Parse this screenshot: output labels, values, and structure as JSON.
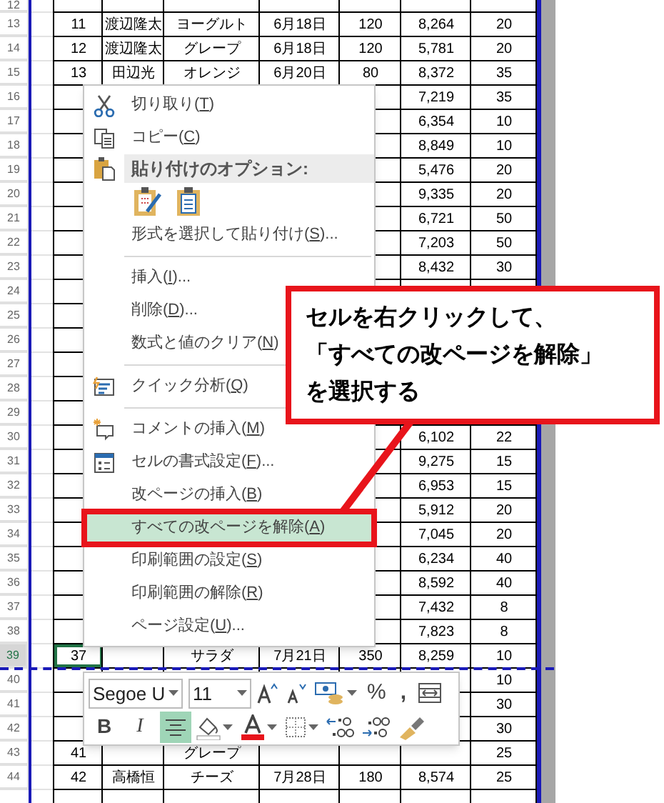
{
  "sheet": {
    "rows": [
      {
        "number": "12",
        "selected": false,
        "page_break_after": false,
        "cells": {}
      },
      {
        "number": "13",
        "selected": false,
        "page_break_after": false,
        "cells": {
          "column_1": "11",
          "column_2": "渡辺隆太",
          "column_3": "ヨーグルト",
          "column_4": "6月18日",
          "column_5": "120",
          "column_6": "8,264",
          "column_7": "20"
        }
      },
      {
        "number": "14",
        "selected": false,
        "page_break_after": false,
        "cells": {
          "column_1": "12",
          "column_2": "渡辺隆太",
          "column_3": "グレープ",
          "column_4": "6月18日",
          "column_5": "120",
          "column_6": "5,781",
          "column_7": "20"
        }
      },
      {
        "number": "15",
        "selected": false,
        "page_break_after": false,
        "cells": {
          "column_1": "13",
          "column_2": "田辺光",
          "column_3": "オレンジ",
          "column_4": "6月20日",
          "column_5": "80",
          "column_6": "8,372",
          "column_7": "35"
        }
      },
      {
        "number": "16",
        "selected": false,
        "page_break_after": false,
        "cells": {
          "column_6": "7,219",
          "column_7": "35"
        }
      },
      {
        "number": "17",
        "selected": false,
        "page_break_after": false,
        "cells": {
          "column_6": "6,354",
          "column_7": "10"
        }
      },
      {
        "number": "18",
        "selected": false,
        "page_break_after": false,
        "cells": {
          "column_6": "8,849",
          "column_7": "10"
        }
      },
      {
        "number": "19",
        "selected": false,
        "page_break_after": false,
        "cells": {
          "column_6": "5,476",
          "column_7": "20"
        }
      },
      {
        "number": "20",
        "selected": false,
        "page_break_after": false,
        "cells": {
          "column_6": "9,335",
          "column_7": "20"
        }
      },
      {
        "number": "21",
        "selected": false,
        "page_break_after": false,
        "cells": {
          "column_6": "6,721",
          "column_7": "50"
        }
      },
      {
        "number": "22",
        "selected": false,
        "page_break_after": false,
        "cells": {
          "column_6": "7,203",
          "column_7": "50"
        }
      },
      {
        "number": "23",
        "selected": false,
        "page_break_after": false,
        "cells": {
          "column_6": "8,432",
          "column_7": "30"
        }
      },
      {
        "number": "24",
        "selected": false,
        "page_break_after": false,
        "cells": {}
      },
      {
        "number": "25",
        "selected": false,
        "page_break_after": false,
        "cells": {}
      },
      {
        "number": "26",
        "selected": false,
        "page_break_after": false,
        "cells": {}
      },
      {
        "number": "27",
        "selected": false,
        "page_break_after": false,
        "cells": {}
      },
      {
        "number": "28",
        "selected": false,
        "page_break_after": false,
        "cells": {}
      },
      {
        "number": "29",
        "selected": false,
        "page_break_after": false,
        "cells": {}
      },
      {
        "number": "30",
        "selected": false,
        "page_break_after": false,
        "cells": {
          "column_6": "6,102",
          "column_7": "22"
        }
      },
      {
        "number": "31",
        "selected": false,
        "page_break_after": false,
        "cells": {
          "column_6": "9,275",
          "column_7": "15"
        }
      },
      {
        "number": "32",
        "selected": false,
        "page_break_after": false,
        "cells": {
          "column_6": "6,953",
          "column_7": "15"
        }
      },
      {
        "number": "33",
        "selected": false,
        "page_break_after": false,
        "cells": {
          "column_6": "5,912",
          "column_7": "20"
        }
      },
      {
        "number": "34",
        "selected": false,
        "page_break_after": false,
        "cells": {
          "column_6": "7,045",
          "column_7": "20"
        }
      },
      {
        "number": "35",
        "selected": false,
        "page_break_after": false,
        "cells": {
          "column_6": "6,234",
          "column_7": "40"
        }
      },
      {
        "number": "36",
        "selected": false,
        "page_break_after": false,
        "cells": {
          "column_6": "8,592",
          "column_7": "40"
        }
      },
      {
        "number": "37",
        "selected": false,
        "page_break_after": false,
        "cells": {
          "column_6": "7,432",
          "column_7": "8"
        }
      },
      {
        "number": "38",
        "selected": false,
        "page_break_after": false,
        "cells": {
          "column_6": "7,823",
          "column_7": "8"
        }
      },
      {
        "number": "39",
        "selected": true,
        "page_break_after": true,
        "cells": {
          "column_1": "37",
          "column_3": "サラダ",
          "column_4": "7月21日",
          "column_5": "350",
          "column_6": "8,259",
          "column_7": "10"
        }
      },
      {
        "number": "40",
        "selected": false,
        "page_break_after": false,
        "cells": {
          "column_7": "10"
        }
      },
      {
        "number": "41",
        "selected": false,
        "page_break_after": false,
        "cells": {
          "column_7": "30"
        }
      },
      {
        "number": "42",
        "selected": false,
        "page_break_after": false,
        "cells": {
          "column_7": "30"
        }
      },
      {
        "number": "43",
        "selected": false,
        "page_break_after": false,
        "cells": {
          "column_1": "41",
          "column_3": "グレープ",
          "column_7": "25"
        }
      },
      {
        "number": "44",
        "selected": false,
        "page_break_after": false,
        "cells": {
          "column_1": "42",
          "column_2": "高橋恒",
          "column_3": "チーズ",
          "column_4": "7月28日",
          "column_5": "180",
          "column_6": "8,574",
          "column_7": "25"
        }
      }
    ]
  },
  "context_menu": {
    "items": [
      {
        "kind": "item",
        "label": "切り取り(",
        "key": "T",
        "after": ")",
        "selected": false
      },
      {
        "kind": "item",
        "label": "コピー(",
        "key": "C",
        "after": ")",
        "selected": false
      },
      {
        "kind": "header",
        "label": "貼り付けのオプション:"
      },
      {
        "kind": "paste_icons"
      },
      {
        "kind": "item",
        "label": "形式を選択して貼り付け(",
        "key": "S",
        "after": ")...",
        "selected": false
      },
      {
        "kind": "separator"
      },
      {
        "kind": "item",
        "label": "挿入(",
        "key": "I",
        "after": ")...",
        "selected": false
      },
      {
        "kind": "item",
        "label": "削除(",
        "key": "D",
        "after": ")...",
        "selected": false
      },
      {
        "kind": "item",
        "label": "数式と値のクリア(",
        "key": "N",
        "after": ")",
        "selected": false
      },
      {
        "kind": "separator"
      },
      {
        "kind": "item",
        "label": "クイック分析(",
        "key": "Q",
        "after": ")",
        "selected": false
      },
      {
        "kind": "separator"
      },
      {
        "kind": "item",
        "label": "コメントの挿入(",
        "key": "M",
        "after": ")",
        "selected": false
      },
      {
        "kind": "item",
        "label": "セルの書式設定(",
        "key": "F",
        "after": ")...",
        "selected": false
      },
      {
        "kind": "item",
        "label": "改ページの挿入(",
        "key": "B",
        "after": ")",
        "selected": false
      },
      {
        "kind": "item",
        "label": "すべての改ページを解除(",
        "key": "A",
        "after": ")",
        "selected": true
      },
      {
        "kind": "item",
        "label": "印刷範囲の設定(",
        "key": "S",
        "after": ")",
        "selected": false
      },
      {
        "kind": "item",
        "label": "印刷範囲の解除(",
        "key": "R",
        "after": ")",
        "selected": false
      },
      {
        "kind": "item",
        "label": "ページ設定(",
        "key": "U",
        "after": ")...",
        "selected": false
      }
    ]
  },
  "callout": {
    "lines": [
      "セルを右クリックして、",
      "「すべての改ページを解除」",
      "を選択する"
    ]
  },
  "mini_toolbar": {
    "font": "Segoe U",
    "size": "11",
    "percent": "%",
    "comma": ",",
    "bold": {
      "label": "B",
      "on": false
    },
    "italic": {
      "label": "I",
      "on": false
    },
    "center": {
      "on": true
    }
  }
}
